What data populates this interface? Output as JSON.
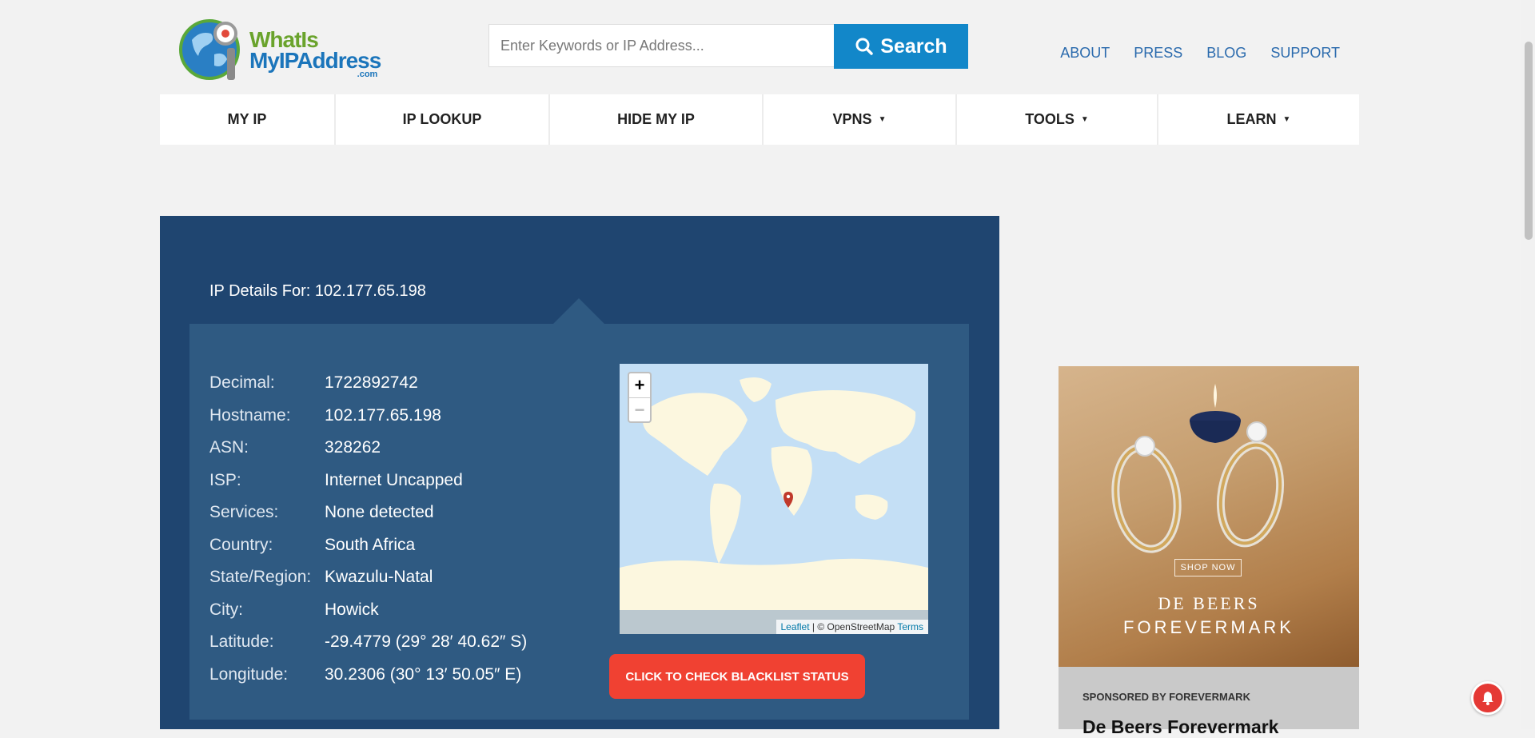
{
  "header": {
    "logo": {
      "line1": "WhatIs",
      "line2": "MyIPAddress",
      "line3": ".com"
    },
    "search": {
      "placeholder": "Enter Keywords or IP Address...",
      "button_label": "Search"
    },
    "top_links": [
      "ABOUT",
      "PRESS",
      "BLOG",
      "SUPPORT"
    ]
  },
  "nav": {
    "items": [
      {
        "label": "MY IP"
      },
      {
        "label": "IP LOOKUP"
      },
      {
        "label": "HIDE MY IP"
      },
      {
        "label": "VPNS"
      },
      {
        "label": "TOOLS"
      },
      {
        "label": "LEARN"
      }
    ]
  },
  "ip_details": {
    "title": "IP Details For: 102.177.65.198",
    "rows": [
      {
        "label": "Decimal:",
        "value": "1722892742"
      },
      {
        "label": "Hostname:",
        "value": "102.177.65.198"
      },
      {
        "label": "ASN:",
        "value": "328262"
      },
      {
        "label": "ISP:",
        "value": "Internet Uncapped"
      },
      {
        "label": "Services:",
        "value": "None detected"
      },
      {
        "label": "Country:",
        "value": "South Africa"
      },
      {
        "label": "State/Region:",
        "value": "Kwazulu-Natal"
      },
      {
        "label": "City:",
        "value": "Howick"
      },
      {
        "label": "Latitude:",
        "value": "-29.4779  (29° 28′ 40.62″ S)"
      },
      {
        "label": "Longitude:",
        "value": "30.2306  (30° 13′ 50.05″ E)"
      }
    ],
    "blacklist_button": "CLICK TO CHECK BLACKLIST STATUS"
  },
  "map": {
    "zoom_in": "+",
    "zoom_out": "−",
    "attribution": {
      "leaflet": "Leaflet",
      "separator": " | © OpenStreetMap ",
      "terms": "Terms"
    }
  },
  "ad": {
    "shop_now": "SHOP NOW",
    "brand_line1": "DE BEERS",
    "brand_line2": "FOREVERMARK",
    "sponsor": "SPONSORED BY FOREVERMARK",
    "headline": "De Beers Forevermark"
  },
  "colors": {
    "panel": "#1f4570",
    "inner_panel": "#2f5a82",
    "search_button": "#1287c9",
    "blacklist_button": "#f04132",
    "link": "#2a6aad"
  }
}
